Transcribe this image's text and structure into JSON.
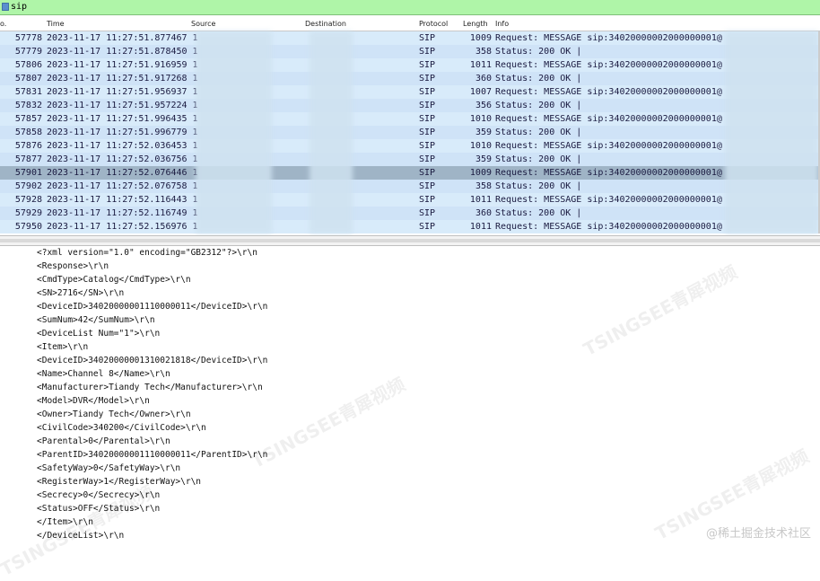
{
  "filter": {
    "value": "sip"
  },
  "columns": {
    "no": "o.",
    "time": "Time",
    "source": "Source",
    "destination": "Destination",
    "protocol": "Protocol",
    "length": "Length",
    "info": "Info"
  },
  "packets": [
    {
      "no": "57778",
      "time": "2023-11-17 11:27:51.877467 1",
      "protocol": "SIP",
      "length": "1009",
      "info": "Request: MESSAGE sip:34020000002000000001@",
      "selected": false
    },
    {
      "no": "57779",
      "time": "2023-11-17 11:27:51.878450 1",
      "protocol": "SIP",
      "length": "358",
      "info": "Status: 200 OK |",
      "selected": false
    },
    {
      "no": "57806",
      "time": "2023-11-17 11:27:51.916959 1",
      "protocol": "SIP",
      "length": "1011",
      "info": "Request: MESSAGE sip:34020000002000000001@",
      "selected": false
    },
    {
      "no": "57807",
      "time": "2023-11-17 11:27:51.917268 1",
      "protocol": "SIP",
      "length": "360",
      "info": "Status: 200 OK |",
      "selected": false
    },
    {
      "no": "57831",
      "time": "2023-11-17 11:27:51.956937 1",
      "protocol": "SIP",
      "length": "1007",
      "info": "Request: MESSAGE sip:34020000002000000001@",
      "selected": false
    },
    {
      "no": "57832",
      "time": "2023-11-17 11:27:51.957224 1",
      "protocol": "SIP",
      "length": "356",
      "info": "Status: 200 OK |",
      "selected": false
    },
    {
      "no": "57857",
      "time": "2023-11-17 11:27:51.996435 1",
      "protocol": "SIP",
      "length": "1010",
      "info": "Request: MESSAGE sip:34020000002000000001@",
      "selected": false
    },
    {
      "no": "57858",
      "time": "2023-11-17 11:27:51.996779 1",
      "protocol": "SIP",
      "length": "359",
      "info": "Status: 200 OK |",
      "selected": false
    },
    {
      "no": "57876",
      "time": "2023-11-17 11:27:52.036453 1",
      "protocol": "SIP",
      "length": "1010",
      "info": "Request: MESSAGE sip:34020000002000000001@",
      "selected": false
    },
    {
      "no": "57877",
      "time": "2023-11-17 11:27:52.036756 1",
      "protocol": "SIP",
      "length": "359",
      "info": "Status: 200 OK |",
      "selected": false
    },
    {
      "no": "57901",
      "time": "2023-11-17 11:27:52.076446 1",
      "protocol": "SIP",
      "length": "1009",
      "info": "Request: MESSAGE sip:34020000002000000001@",
      "selected": true
    },
    {
      "no": "57902",
      "time": "2023-11-17 11:27:52.076758 1",
      "protocol": "SIP",
      "length": "358",
      "info": "Status: 200 OK |",
      "selected": false
    },
    {
      "no": "57928",
      "time": "2023-11-17 11:27:52.116443 1",
      "protocol": "SIP",
      "length": "1011",
      "info": "Request: MESSAGE sip:34020000002000000001@",
      "selected": false
    },
    {
      "no": "57929",
      "time": "2023-11-17 11:27:52.116749 1",
      "protocol": "SIP",
      "length": "360",
      "info": "Status: 200 OK |",
      "selected": false
    },
    {
      "no": "57950",
      "time": "2023-11-17 11:27:52.156976 1",
      "protocol": "SIP",
      "length": "1011",
      "info": "Request: MESSAGE sip:34020000002000000001@",
      "selected": false
    }
  ],
  "detail_lines": [
    "<?xml version=\"1.0\" encoding=\"GB2312\"?>\\r\\n",
    "<Response>\\r\\n",
    "<CmdType>Catalog</CmdType>\\r\\n",
    "<SN>2716</SN>\\r\\n",
    "<DeviceID>34020000001110000011</DeviceID>\\r\\n",
    "<SumNum>42</SumNum>\\r\\n",
    "<DeviceList Num=\"1\">\\r\\n",
    "<Item>\\r\\n",
    "<DeviceID>34020000001310021818</DeviceID>\\r\\n",
    "<Name>Channel 8</Name>\\r\\n",
    "<Manufacturer>Tiandy Tech</Manufacturer>\\r\\n",
    "<Model>DVR</Model>\\r\\n",
    "<Owner>Tiandy Tech</Owner>\\r\\n",
    "<CivilCode>340200</CivilCode>\\r\\n",
    "<Parental>0</Parental>\\r\\n",
    "<ParentID>34020000001110000011</ParentID>\\r\\n",
    "<SafetyWay>0</SafetyWay>\\r\\n",
    "<RegisterWay>1</RegisterWay>\\r\\n",
    "<Secrecy>0</Secrecy>\\r\\n",
    "<Status>OFF</Status>\\r\\n",
    "</Item>\\r\\n",
    "</DeviceList>\\r\\n"
  ],
  "watermarks": [
    "TSINGSEE青犀视频",
    "TSINGSEE青犀视频",
    "TSINGSEE青犀视频",
    "TSINGSEE青犀视频"
  ],
  "credit": "@稀土掘金技术社区",
  "colors": {
    "row_light": "#d8ebfa",
    "row_alt": "#cfe3f7",
    "row_selected": "#9fb4c6",
    "filter_bg": "#aff5a8"
  }
}
